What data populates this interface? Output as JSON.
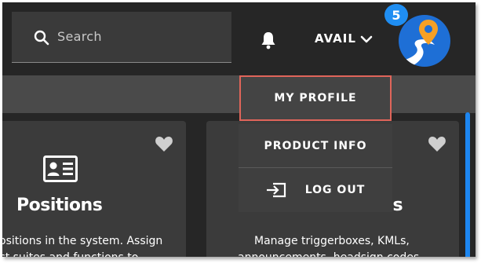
{
  "header": {
    "search_placeholder": "Search",
    "availability_label": "AVAIL",
    "notification_count": "5"
  },
  "user_menu": {
    "items": [
      {
        "label": "MY PROFILE"
      },
      {
        "label": "PRODUCT INFO"
      },
      {
        "label": "LOG OUT"
      }
    ]
  },
  "cards": [
    {
      "title": "Positions",
      "description_lines": [
        "ositions in the system. Assign",
        "ct suites and functions to"
      ]
    },
    {
      "title_fragment": "ls",
      "description_lines": [
        "Manage triggerboxes, KMLs,",
        "announcements, headsign codes,"
      ]
    }
  ],
  "colors": {
    "accent": "#1f8ef2",
    "highlight_border": "#e0655a",
    "background": "#262626",
    "card": "#3b3b3b"
  }
}
